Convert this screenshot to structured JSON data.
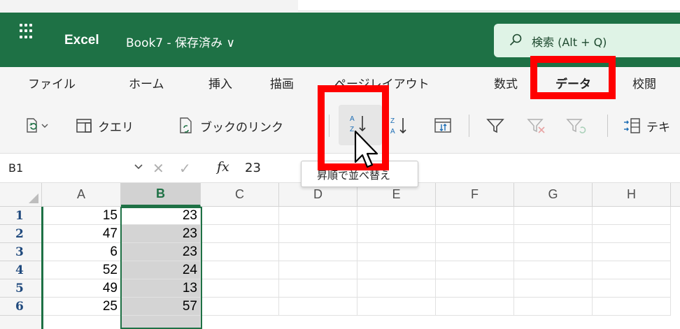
{
  "app": {
    "name": "Excel",
    "doc_title": "Book7 - 保存済み ∨"
  },
  "search": {
    "placeholder": "検索 (Alt + Q)"
  },
  "tabs": [
    {
      "label": "ファイル"
    },
    {
      "label": "ホーム"
    },
    {
      "label": "挿入"
    },
    {
      "label": "描画"
    },
    {
      "label": "ページレイアウト"
    },
    {
      "label": "数式"
    },
    {
      "label": "データ",
      "active": true
    },
    {
      "label": "校閲"
    }
  ],
  "ribbon": {
    "query_label": "クエリ",
    "workbook_links_label": "ブックのリンク",
    "text_to_columns_label": "テキ"
  },
  "formula_bar": {
    "name_box": "B1",
    "fx_label": "fx",
    "value": "23"
  },
  "tooltip": {
    "text": "昇順で並べ替え"
  },
  "grid": {
    "columns": [
      "A",
      "B",
      "C",
      "D",
      "E",
      "F",
      "G",
      "H"
    ],
    "rows": [
      {
        "num": "1",
        "a": "15",
        "b": "23"
      },
      {
        "num": "2",
        "a": "47",
        "b": "23"
      },
      {
        "num": "3",
        "a": "6",
        "b": "23"
      },
      {
        "num": "4",
        "a": "52",
        "b": "24"
      },
      {
        "num": "5",
        "a": "49",
        "b": "13"
      },
      {
        "num": "6",
        "a": "25",
        "b": "57"
      }
    ]
  },
  "icons": [
    "waffle-icon",
    "search-icon",
    "refresh-all-icon",
    "queries-icon",
    "workbook-links-icon",
    "sort-ascending-icon",
    "sort-descending-icon",
    "custom-sort-icon",
    "filter-icon",
    "clear-filter-icon",
    "reapply-filter-icon",
    "text-to-columns-icon",
    "mouse-pointer-icon"
  ],
  "colors": {
    "excel_green": "#1e7145",
    "highlight_red": "#ff0000",
    "selection_gray": "#d4d4d4"
  }
}
